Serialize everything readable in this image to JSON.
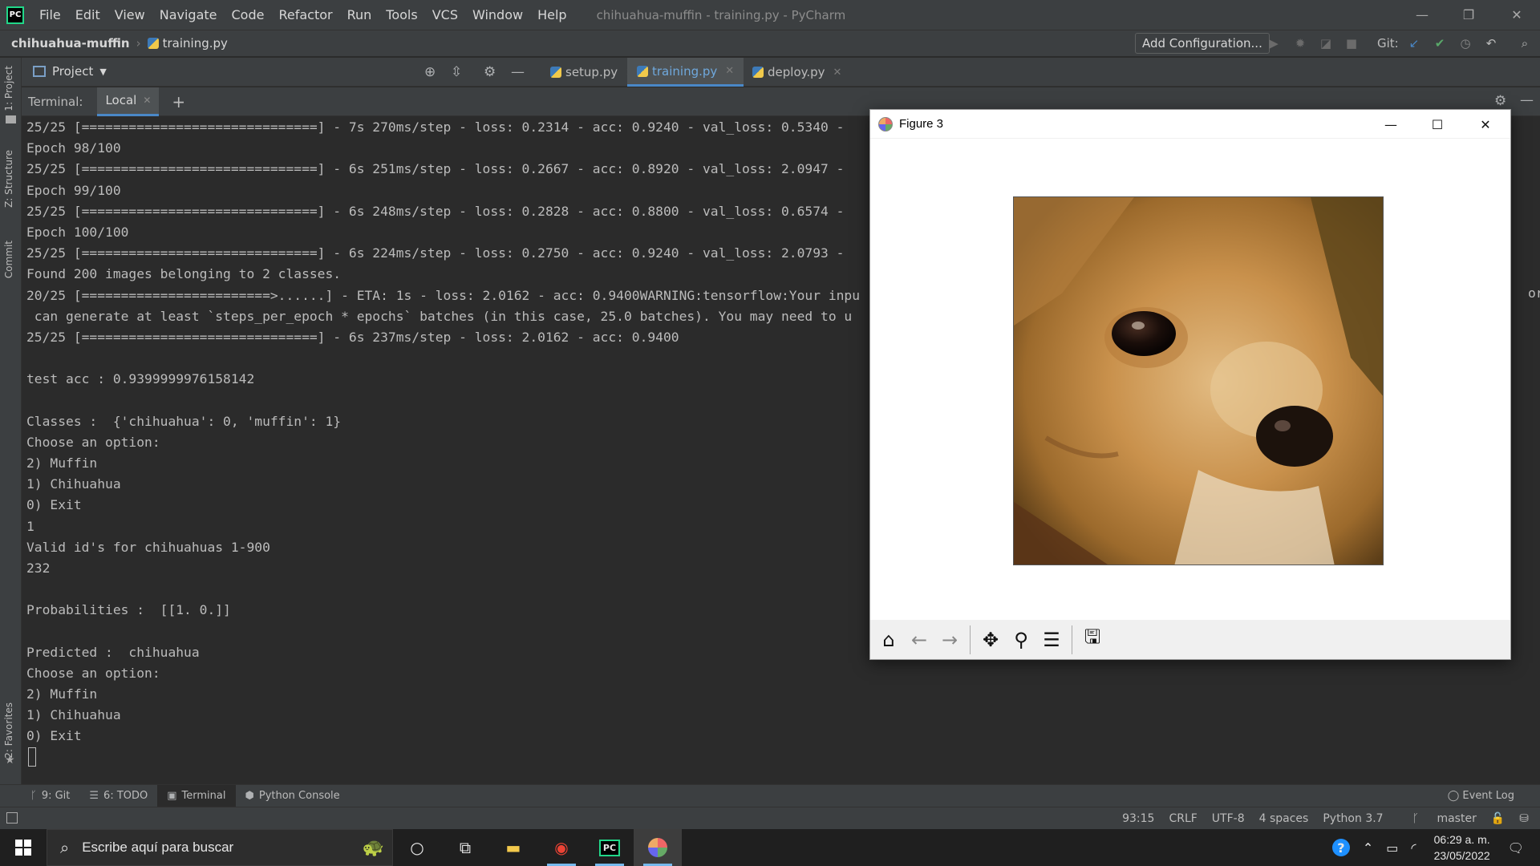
{
  "titlebar": {
    "app_icon_text": "PC",
    "menu": [
      "File",
      "Edit",
      "View",
      "Navigate",
      "Code",
      "Refactor",
      "Run",
      "Tools",
      "VCS",
      "Window",
      "Help"
    ],
    "window_title": "chihuahua-muffin - training.py - PyCharm"
  },
  "navbar": {
    "project": "chihuahua-muffin",
    "file": "training.py",
    "add_configuration": "Add Configuration...",
    "git_label": "Git:"
  },
  "left_strip": {
    "project_tab": "1: Project",
    "structure_tab": "Z: Structure",
    "commit_tab": "Commit",
    "favorites_tab": "2: Favorites"
  },
  "project_panel": {
    "label": "Project"
  },
  "editor_tabs": [
    {
      "label": "setup.py",
      "active": false
    },
    {
      "label": "training.py",
      "active": true
    },
    {
      "label": "deploy.py",
      "active": false
    }
  ],
  "terminal_header": {
    "label": "Terminal:",
    "tab": "Local"
  },
  "terminal_lines": [
    "25/25 [==============================] - 7s 270ms/step - loss: 0.2314 - acc: 0.9240 - val_loss: 0.5340 -",
    "Epoch 98/100",
    "25/25 [==============================] - 6s 251ms/step - loss: 0.2667 - acc: 0.8920 - val_loss: 2.0947 -",
    "Epoch 99/100",
    "25/25 [==============================] - 6s 248ms/step - loss: 0.2828 - acc: 0.8800 - val_loss: 0.6574 -",
    "Epoch 100/100",
    "25/25 [==============================] - 6s 224ms/step - loss: 0.2750 - acc: 0.9240 - val_loss: 2.0793 -",
    "Found 200 images belonging to 2 classes.",
    "20/25 [========================>......] - ETA: 1s - loss: 2.0162 - acc: 0.9400WARNING:tensorflow:Your inpu",
    " can generate at least `steps_per_epoch * epochs` batches (in this case, 25.0 batches). You may need to u",
    "25/25 [==============================] - 6s 237ms/step - loss: 2.0162 - acc: 0.9400",
    "",
    "test acc : 0.9399999976158142",
    "",
    "Classes :  {'chihuahua': 0, 'muffin': 1}",
    "Choose an option:",
    "2) Muffin",
    "1) Chihuahua",
    "0) Exit",
    "1",
    "Valid id's for chihuahuas 1-900",
    "232",
    "",
    "Probabilities :  [[1. 0.]]",
    "",
    "Predicted :  chihuahua",
    "Choose an option:",
    "2) Muffin",
    "1) Chihuahua",
    "0) Exit"
  ],
  "terminal_overflow_text": "or",
  "figure": {
    "title": "Figure 3",
    "image_subject": "chihuahua face photo",
    "toolbar_icons": [
      "home-icon",
      "back-arrow-icon",
      "forward-arrow-icon",
      "pan-icon",
      "zoom-icon",
      "configure-subplots-icon",
      "save-icon"
    ]
  },
  "bottom_tabs": [
    {
      "label": "9: Git",
      "icon": "git-branch-icon"
    },
    {
      "label": "6: TODO",
      "icon": "todo-list-icon"
    },
    {
      "label": "Terminal",
      "icon": "terminal-icon",
      "active": true
    },
    {
      "label": "Python Console",
      "icon": "python-icon"
    }
  ],
  "event_log": "Event Log",
  "statusbar": {
    "position": "93:15",
    "line_sep": "CRLF",
    "encoding": "UTF-8",
    "indent": "4 spaces",
    "interpreter": "Python 3.7",
    "branch": "master"
  },
  "taskbar": {
    "search_placeholder": "Escribe aquí para buscar",
    "time": "06:29 a. m.",
    "date": "23/05/2022"
  },
  "colors": {
    "ide_bg": "#2b2b2b",
    "panel_bg": "#3c3f41",
    "accent": "#4a88c7",
    "git_check": "#59a869"
  }
}
